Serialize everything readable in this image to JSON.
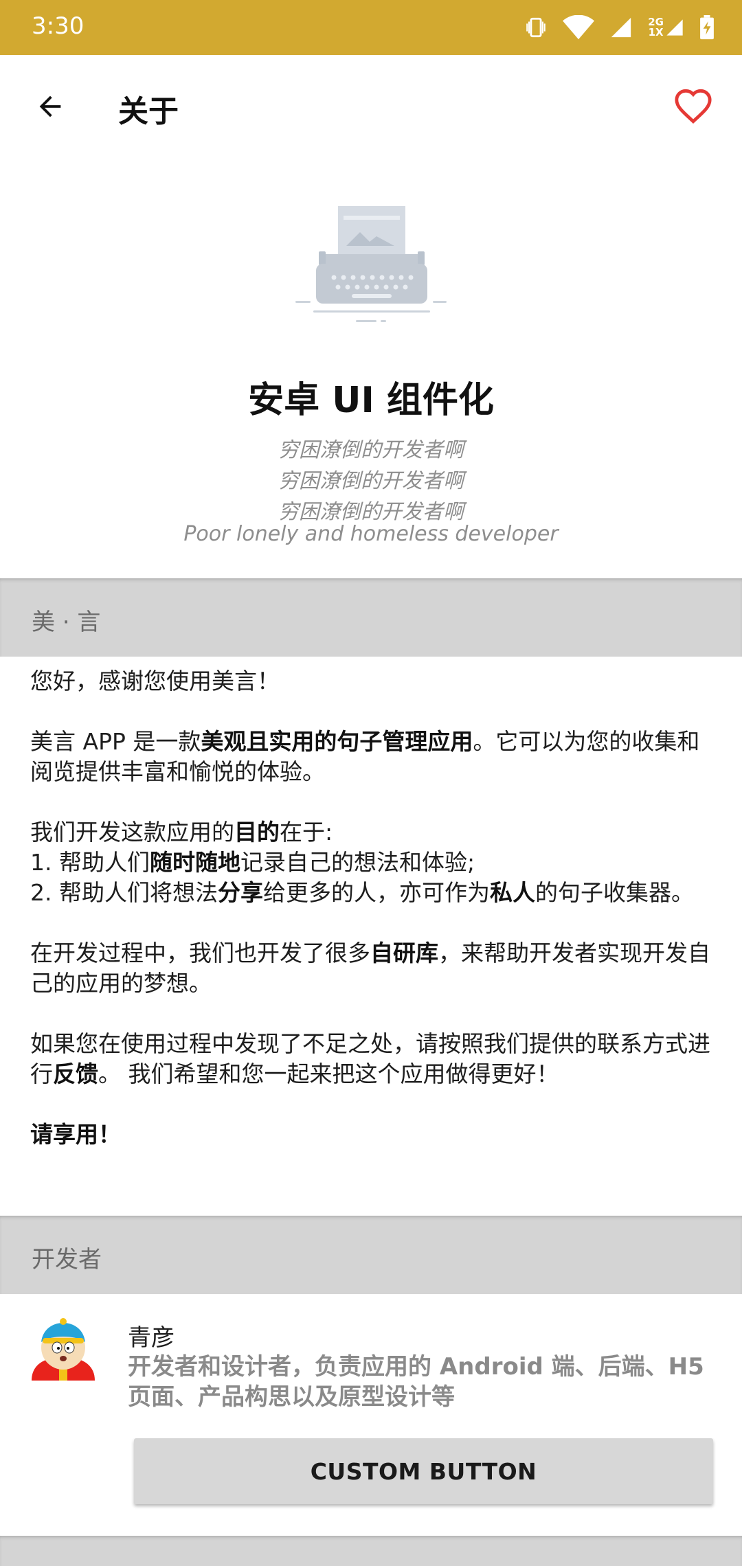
{
  "status_bar": {
    "time": "3:30",
    "network_top": "2G",
    "network_bottom": "1X",
    "background": "#d2a930"
  },
  "toolbar": {
    "title": "关于",
    "back_icon": "arrow-back-icon",
    "favorite_icon": "heart-outline-icon",
    "favorite_color": "#e53935"
  },
  "hero": {
    "illustration": "typewriter-illustration",
    "app_name": "安卓 UI 组件化",
    "slogans": [
      "穷困潦倒的开发者啊",
      "穷困潦倒的开发者啊",
      "穷困潦倒的开发者啊"
    ],
    "slogan_en": "Poor lonely and homeless developer"
  },
  "section_meiyan": {
    "label": "美 · 言"
  },
  "description": {
    "greeting": "您好，感谢您使用美言！",
    "p2_a": "美言 APP 是一款",
    "p2_b": "美观且实用的句子管理应用",
    "p2_c": "。它可以为您的收集和阅览提供丰富和愉悦的体验。",
    "p3_intro_a": "我们开发这款应用的",
    "p3_intro_b": "目的",
    "p3_intro_c": "在于:",
    "p3_item1_a": "1. 帮助人们",
    "p3_item1_b": "随时随地",
    "p3_item1_c": "记录自己的想法和体验;",
    "p3_item2_a": "2. 帮助人们将想法",
    "p3_item2_b": "分享",
    "p3_item2_c": "给更多的人，亦可作为",
    "p3_item2_d": "私人",
    "p3_item2_e": "的句子收集器。",
    "p4_a": "在开发过程中，我们也开发了很多",
    "p4_b": "自研库",
    "p4_c": "，来帮助开发者实现开发自己的应用的梦想。",
    "p5_a": "如果您在使用过程中发现了不足之处，请按照我们提供的联系方式进行",
    "p5_b": "反馈",
    "p5_c": "。 我们希望和您一起来把这个应用做得更好！",
    "closing": "请享用！"
  },
  "section_developer": {
    "label": "开发者"
  },
  "developer": {
    "avatar": "cartoon-avatar",
    "name": "青彦",
    "role": "开发者和设计者，负责应用的 Android 端、后端、H5 页面、产品构思以及原型设计等",
    "button_label": "CUSTOM BUTTON"
  }
}
